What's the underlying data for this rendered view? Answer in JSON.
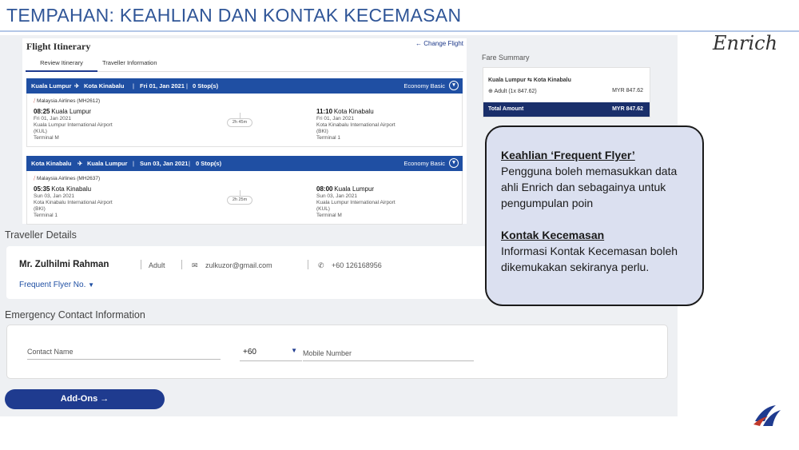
{
  "slide": {
    "title": "TEMPAHAN: KEAHLIAN DAN KONTAK KECEMASAN"
  },
  "brand": {
    "enrich_logo": "Enrich",
    "accent": "#1f3b8f",
    "bar_blue": "#1f4fa3"
  },
  "itinerary": {
    "title": "Flight Itinerary",
    "change_flight": "← Change Flight",
    "tabs": [
      {
        "label": "Review Itinerary",
        "active": true
      },
      {
        "label": "Traveller Information",
        "active": false
      }
    ],
    "segments": [
      {
        "from": "Kuala Lumpur",
        "to": "Kota Kinabalu",
        "date": "Fri 01, Jan 2021",
        "stops": "0 Stop(s)",
        "cabin": "Economy Basic",
        "airline": "Malaysia Airlines (MH2612)",
        "dep_time": "08:25",
        "dep_city": "Kuala Lumpur",
        "dep_date": "Fri 01, Jan 2021",
        "dep_airport": "Kuala Lumpur International Airport",
        "dep_code": "(KUL)",
        "dep_terminal": "Terminal M",
        "duration": "2h 45m",
        "arr_time": "11:10",
        "arr_city": "Kota Kinabalu",
        "arr_date": "Fri 01, Jan 2021",
        "arr_airport": "Kota Kinabalu International Airport",
        "arr_code": "(BKI)",
        "arr_terminal": "Terminal 1"
      },
      {
        "from": "Kota Kinabalu",
        "to": "Kuala Lumpur",
        "date": "Sun 03, Jan 2021",
        "stops": "0 Stop(s)",
        "cabin": "Economy Basic",
        "airline": "Malaysia Airlines (MH2637)",
        "dep_time": "05:35",
        "dep_city": "Kota Kinabalu",
        "dep_date": "Sun 03, Jan 2021",
        "dep_airport": "Kota Kinabalu International Airport",
        "dep_code": "(BKI)",
        "dep_terminal": "Terminal 1",
        "duration": "2h 25m",
        "arr_time": "08:00",
        "arr_city": "Kuala Lumpur",
        "arr_date": "Sun 03, Jan 2021",
        "arr_airport": "Kuala Lumpur International Airport",
        "arr_code": "(KUL)",
        "arr_terminal": "Terminal M"
      }
    ]
  },
  "fare": {
    "title": "Fare Summary",
    "route": "Kuala Lumpur ⇆ Kota Kinabalu",
    "pax_line": "Adult (1x 847.62)",
    "pax_amount": "MYR 847.62",
    "total_label": "Total Amount",
    "total_amount": "MYR 847.62"
  },
  "traveller": {
    "section_title": "Traveller Details",
    "name": "Mr. Zulhilmi Rahman",
    "type": "Adult",
    "email": "zulkuzor@gmail.com",
    "phone": "+60 126168956",
    "ff_label": "Frequent Flyer No."
  },
  "emergency": {
    "section_title": "Emergency Contact Information",
    "contact_placeholder": "Contact Name",
    "country_code": "+60",
    "mobile_placeholder": "Mobile Number"
  },
  "addons_button": "Add-Ons →",
  "callout": {
    "h1": "Keahlian ‘Frequent Flyer’",
    "p1": "Pengguna boleh memasukkan data ahli Enrich dan sebagainya untuk pengumpulan poin",
    "h2": "Kontak Kecemasan",
    "p2": "Informasi Kontak Kecemasan boleh dikemukakan sekiranya perlu."
  }
}
